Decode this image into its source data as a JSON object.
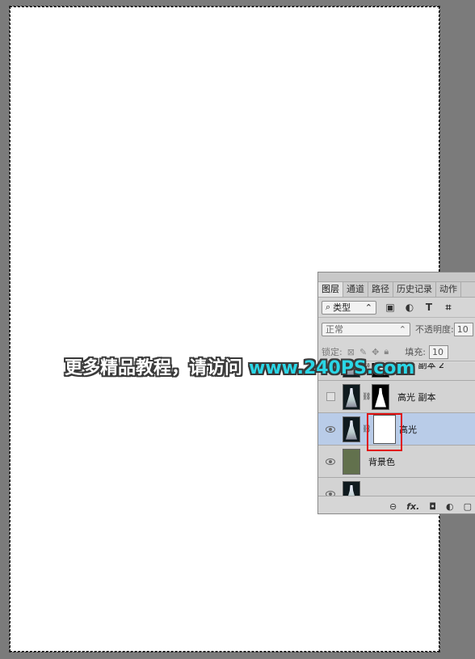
{
  "panel": {
    "tabs": [
      "图层",
      "通道",
      "路径",
      "历史记录",
      "动作"
    ],
    "filter": {
      "label": "类型",
      "icon": "search-icon"
    },
    "filter_icons": [
      "image-filter-icon",
      "adjustment-filter-icon",
      "text-filter-icon",
      "shape-filter-icon"
    ],
    "blend_mode": "正常",
    "opacity_label": "不透明度:",
    "opacity_value": "10",
    "lock_label": "锁定:",
    "fill_label": "填充:",
    "fill_value": "10",
    "layers": [
      {
        "name": "高光 副本 2",
        "visible": true
      },
      {
        "name": "高光 副本",
        "visible": false
      },
      {
        "name": "高光",
        "visible": true,
        "selected": true
      },
      {
        "name": "背景色",
        "visible": true
      },
      {
        "name": "",
        "visible": true
      }
    ],
    "bottom_icons": [
      "link-icon",
      "fx-icon",
      "mask-icon",
      "adjustment-icon",
      "new-layer-icon"
    ],
    "fx_label": "fx."
  },
  "watermark": {
    "text": "更多精品教程，请访问",
    "url": "www.240PS.com"
  },
  "colors": {
    "background": "#7b7b7b",
    "fill_layer": "#62714d",
    "selection": "#b9cce8",
    "highlight_box": "#e01010",
    "watermark_url": "#2ad6e6"
  }
}
